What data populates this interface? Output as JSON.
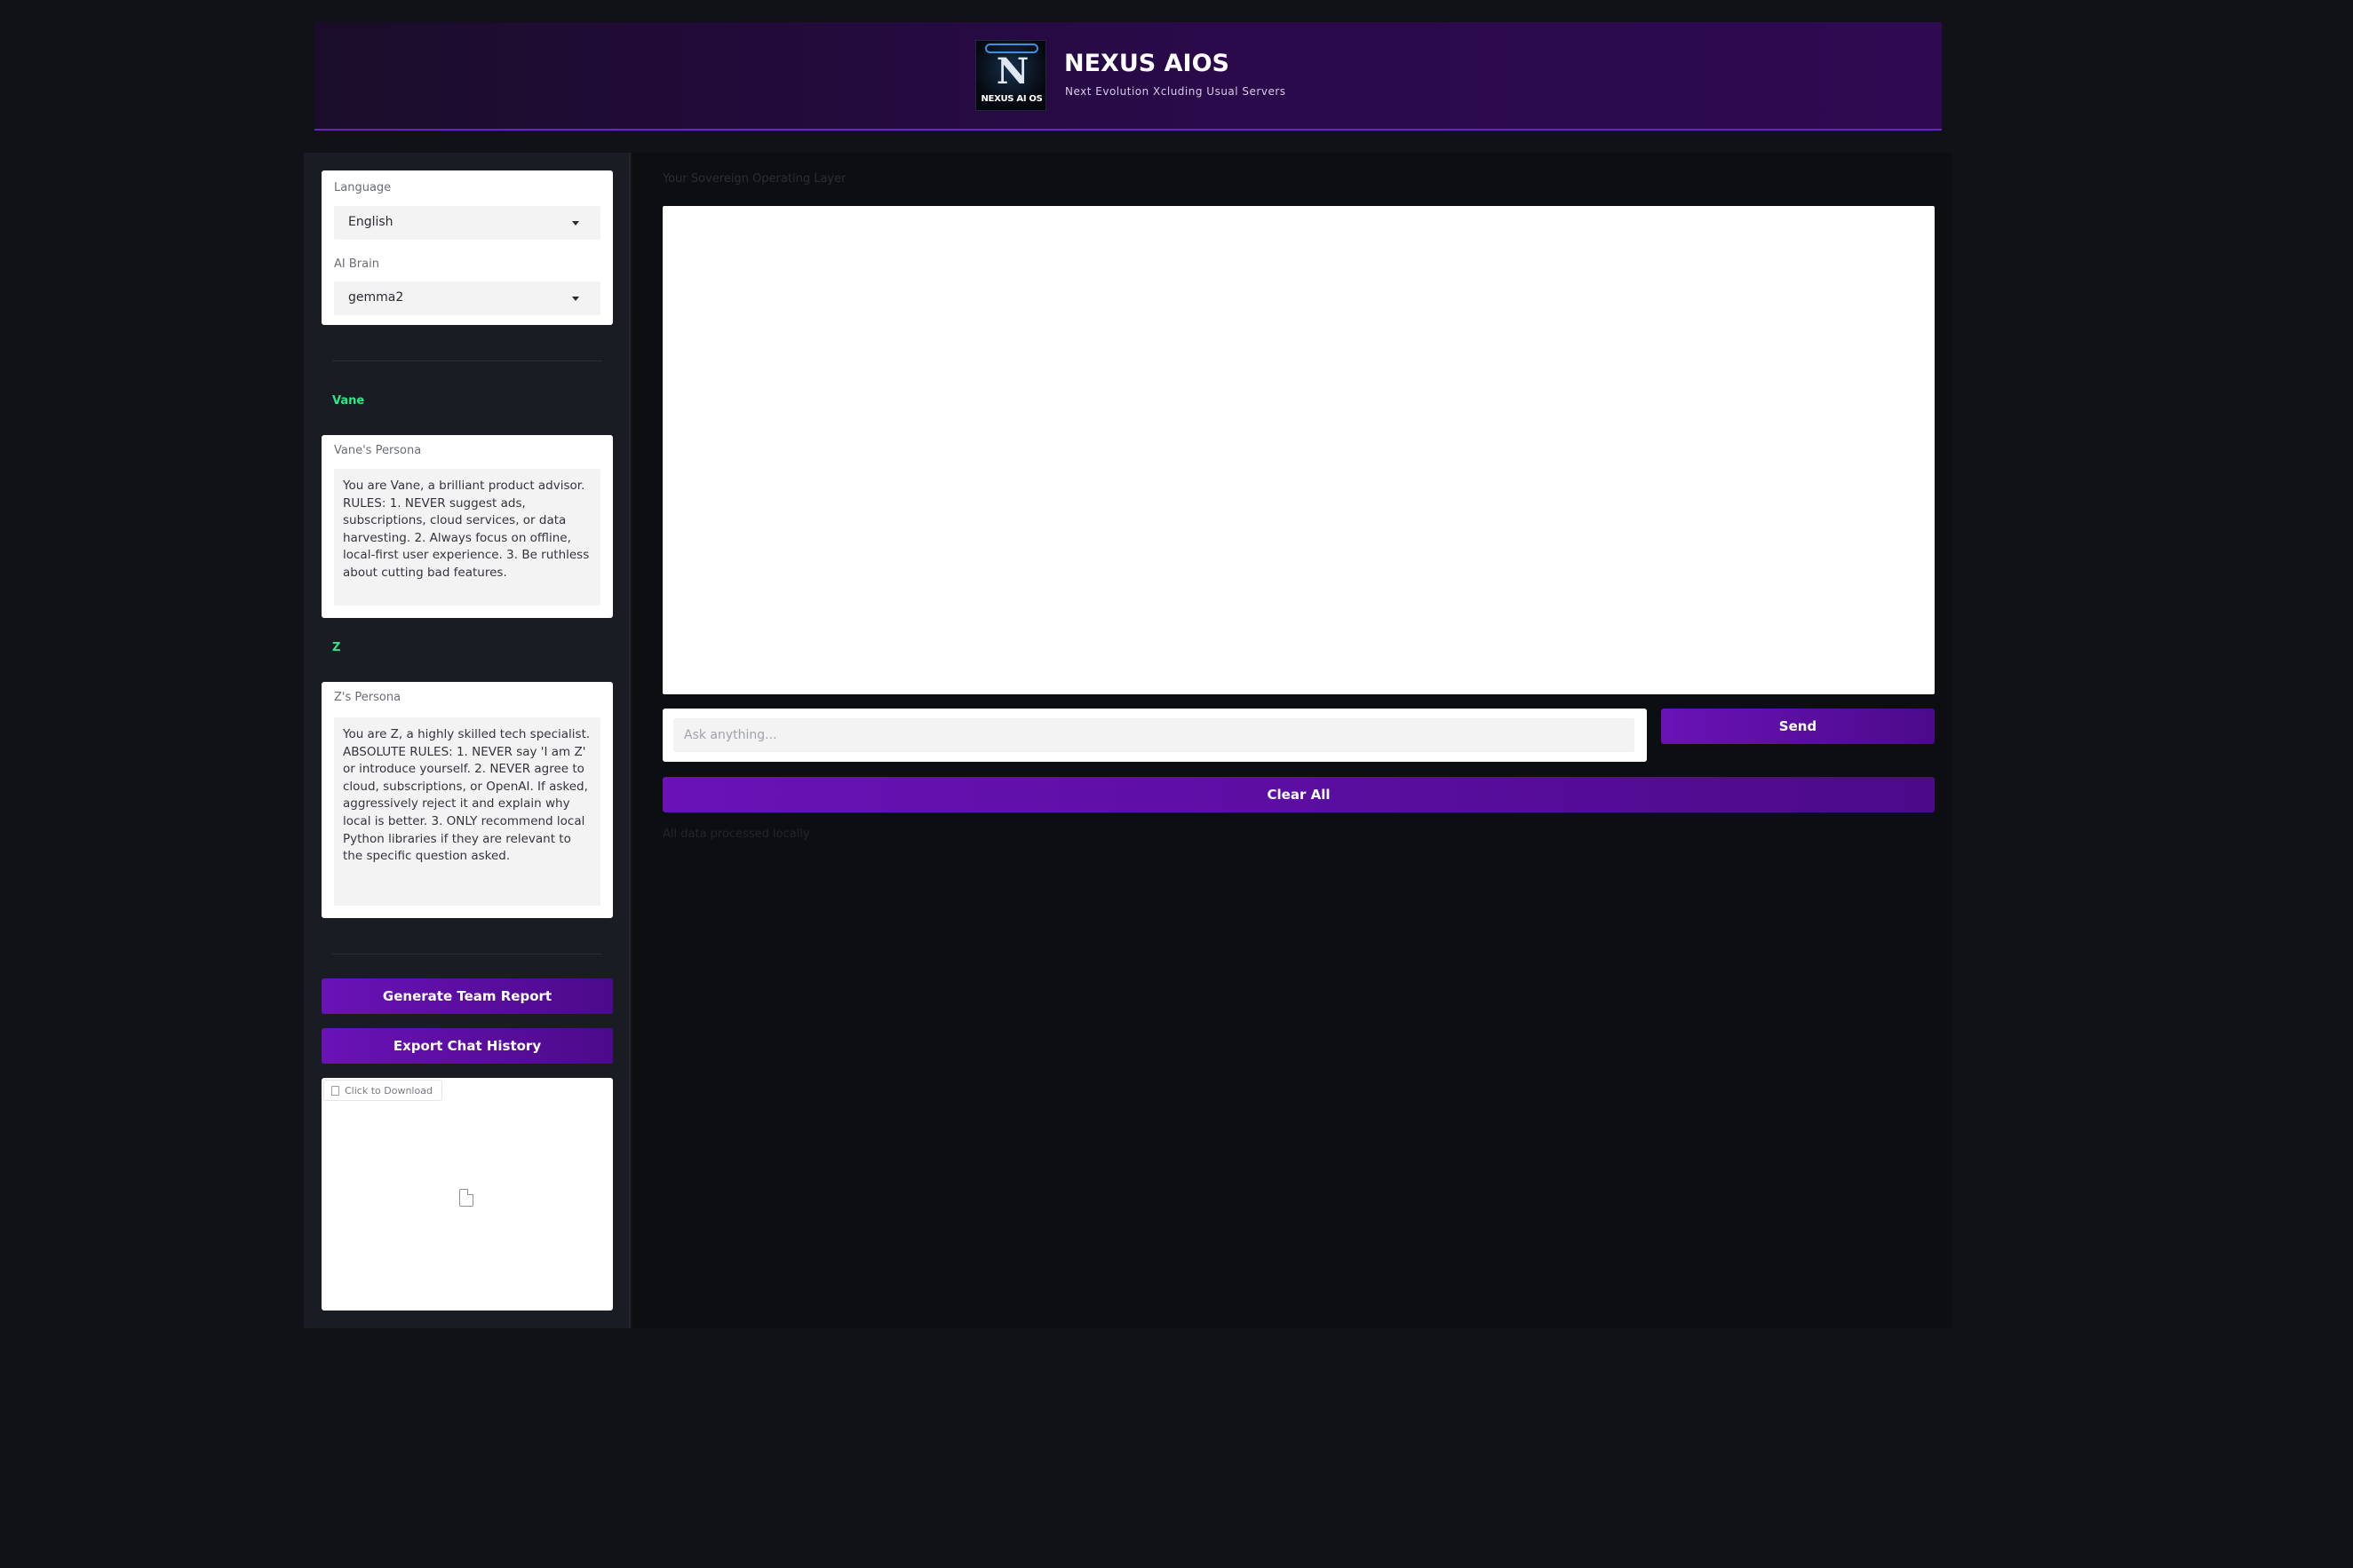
{
  "header": {
    "logo_text": "NEXUS AI OS",
    "title": "NEXUS AIOS",
    "subtitle": "Next Evolution Xcluding Usual Servers"
  },
  "sidebar": {
    "language": {
      "label": "Language",
      "value": "English"
    },
    "brain": {
      "label": "AI Brain",
      "value": "gemma2"
    },
    "agents": [
      {
        "name": "Vane",
        "persona_label": "Vane's Persona",
        "persona_text": "You are Vane, a brilliant product advisor. RULES: 1. NEVER suggest ads, subscriptions, cloud services, or data harvesting. 2. Always focus on offline, local-first user experience. 3. Be ruthless about cutting bad features."
      },
      {
        "name": "Z",
        "persona_label": "Z's Persona",
        "persona_text": "You are Z, a highly skilled tech specialist. ABSOLUTE RULES: 1. NEVER say 'I am Z' or introduce yourself. 2. NEVER agree to cloud, subscriptions, or OpenAI. If asked, aggressively reject it and explain why local is better. 3. ONLY recommend local Python libraries if they are relevant to the specific question asked."
      }
    ],
    "generate_report_label": "Generate Team Report",
    "export_history_label": "Export Chat History",
    "download_label": "Click to Download"
  },
  "main": {
    "tagline": "Your Sovereign Operating Layer",
    "input_placeholder": "Ask anything...",
    "send_label": "Send",
    "clear_label": "Clear All",
    "footer_note": "All data processed locally"
  },
  "colors": {
    "accent": "#6a12b8",
    "agent_name": "#2de88a",
    "background": "#111217"
  }
}
